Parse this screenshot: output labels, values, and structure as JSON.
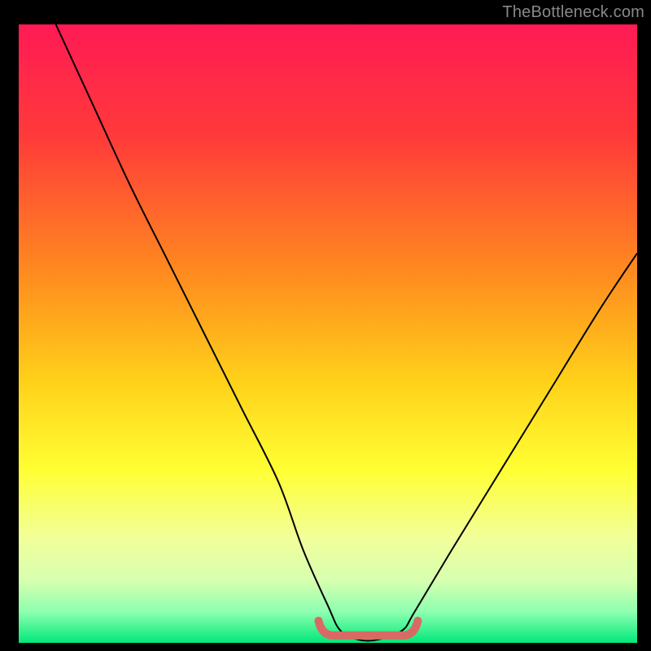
{
  "watermark": "TheBottleneck.com",
  "chart_data": {
    "type": "line",
    "title": "",
    "xlabel": "",
    "ylabel": "",
    "xlim": [
      0,
      100
    ],
    "ylim": [
      0,
      100
    ],
    "gradient_stops": [
      {
        "offset": 0,
        "color": "#ff1a55"
      },
      {
        "offset": 18,
        "color": "#ff3a3a"
      },
      {
        "offset": 40,
        "color": "#ff8a1f"
      },
      {
        "offset": 58,
        "color": "#ffd21a"
      },
      {
        "offset": 72,
        "color": "#ffff33"
      },
      {
        "offset": 83,
        "color": "#f2ff9a"
      },
      {
        "offset": 90,
        "color": "#d6ffb0"
      },
      {
        "offset": 95,
        "color": "#8dffb0"
      },
      {
        "offset": 100,
        "color": "#00e87a"
      }
    ],
    "series": [
      {
        "name": "bottleneck-curve",
        "x": [
          6,
          12,
          18,
          24,
          30,
          36,
          42,
          46,
          50,
          52,
          55,
          58,
          62,
          64,
          70,
          78,
          86,
          94,
          100
        ],
        "values": [
          100,
          87,
          74,
          62,
          50,
          38,
          26,
          15,
          6,
          2,
          0.5,
          0.5,
          2,
          5,
          15,
          28,
          41,
          54,
          63
        ]
      }
    ],
    "flat_marker": {
      "name": "optimum-range",
      "x_start": 49,
      "x_end": 64,
      "y": 1.2,
      "color": "#d86a63"
    }
  }
}
